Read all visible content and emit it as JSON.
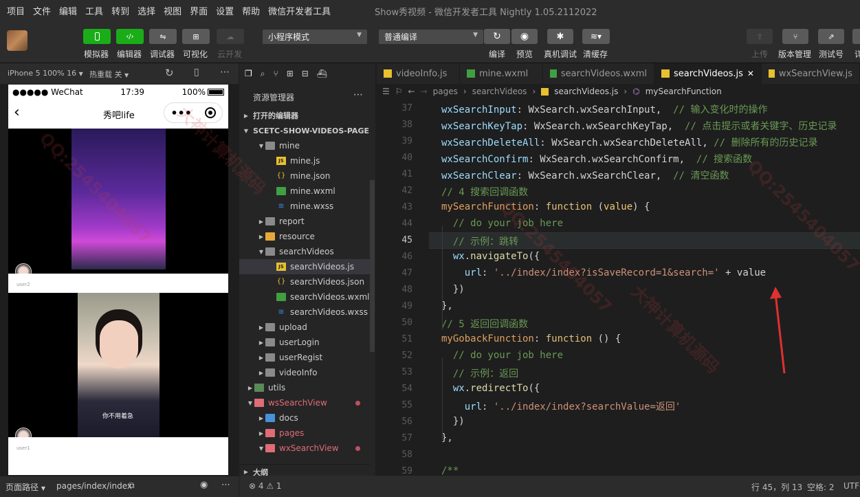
{
  "menu": [
    "项目",
    "文件",
    "编辑",
    "工具",
    "转到",
    "选择",
    "视图",
    "界面",
    "设置",
    "帮助",
    "微信开发者工具"
  ],
  "window_title": "Show秀视频 - 微信开发者工具 Nightly 1.05.2112022",
  "toolbar": {
    "simulator": "模拟器",
    "editor": "编辑器",
    "debugger": "调试器",
    "visual": "可视化",
    "cloud": "云开发",
    "mode_select": "小程序模式",
    "compile_select": "普通编译",
    "compile": "编译",
    "preview": "预览",
    "real_debug": "真机调试",
    "clear_cache": "清缓存",
    "upload": "上传",
    "version_mgmt": "版本管理",
    "test_account": "测试号",
    "details": "详"
  },
  "simulator": {
    "device": "iPhone 5 100% 16",
    "hot_reload": "热重载 关",
    "status_left": "●●●●● WeChat",
    "time": "17:39",
    "battery": "100%",
    "nav_title": "秀吧life",
    "user_top": "user2",
    "user_bottom": "user1",
    "caption": "你不用着急",
    "page_path_label": "页面路径",
    "page_path": "pages/index/index"
  },
  "explorer": {
    "title": "资源管理器",
    "open_editors": "打开的编辑器",
    "project": "SCETC-SHOW-VIDEOS-PAGE",
    "items": [
      {
        "label": "mine",
        "type": "folder-open",
        "indent": 1
      },
      {
        "label": "mine.js",
        "type": "js",
        "indent": 2
      },
      {
        "label": "mine.json",
        "type": "json",
        "indent": 2
      },
      {
        "label": "mine.wxml",
        "type": "wxml",
        "indent": 2
      },
      {
        "label": "mine.wxss",
        "type": "wxss",
        "indent": 2
      },
      {
        "label": "report",
        "type": "folder",
        "indent": 1
      },
      {
        "label": "resource",
        "type": "folder-src",
        "indent": 1
      },
      {
        "label": "searchVideos",
        "type": "folder-open",
        "indent": 1
      },
      {
        "label": "searchVideos.js",
        "type": "js",
        "indent": 2,
        "selected": true
      },
      {
        "label": "searchVideos.json",
        "type": "json",
        "indent": 2
      },
      {
        "label": "searchVideos.wxml",
        "type": "wxml",
        "indent": 2
      },
      {
        "label": "searchVideos.wxss",
        "type": "wxss",
        "indent": 2
      },
      {
        "label": "upload",
        "type": "folder",
        "indent": 1
      },
      {
        "label": "userLogin",
        "type": "folder",
        "indent": 1
      },
      {
        "label": "userRegist",
        "type": "folder",
        "indent": 1
      },
      {
        "label": "videoInfo",
        "type": "folder",
        "indent": 1
      },
      {
        "label": "utils",
        "type": "folder-green",
        "indent": 0
      },
      {
        "label": "wsSearchView",
        "type": "folder-red",
        "indent": 0,
        "dot": true
      },
      {
        "label": "docs",
        "type": "folder-blue",
        "indent": 1
      },
      {
        "label": "pages",
        "type": "folder-red",
        "indent": 1
      },
      {
        "label": "wxSearchView",
        "type": "folder-red",
        "indent": 1,
        "dot": true
      }
    ],
    "outline": "大纲"
  },
  "tabs": [
    "videoInfo.js",
    "mine.wxml",
    "searchVideos.wxml",
    "searchVideos.js",
    "wxSearchView.js"
  ],
  "breadcrumb": [
    "pages",
    "searchVideos",
    "searchVideos.js",
    "mySearchFunction"
  ],
  "code_lines": [
    {
      "n": "37",
      "html": "<span class=\"prop\">wxSearchInput</span>: <span class=\"obj\">WxSearch.wxSearchInput</span>,  <span class=\"cm\">// 输入变化时的操作</span>"
    },
    {
      "n": "38",
      "html": "<span class=\"prop\">wxSearchKeyTap</span>: <span class=\"obj\">WxSearch.wxSearchKeyTap</span>,  <span class=\"cm\">// 点击提示或者关键字、历史记录</span>"
    },
    {
      "n": "39",
      "html": "<span class=\"prop\">wxSearchDeleteAll</span>: <span class=\"obj\">WxSearch.wxSearchDeleteAll</span>, <span class=\"cm\">// 删除所有的历史记录</span>"
    },
    {
      "n": "40",
      "html": "<span class=\"prop\">wxSearchConfirm</span>: <span class=\"obj\">WxSearch.wxSearchConfirm</span>,  <span class=\"cm\">// 搜索函数</span>"
    },
    {
      "n": "41",
      "html": "<span class=\"prop\">wxSearchClear</span>: <span class=\"obj\">WxSearch.wxSearchClear</span>,  <span class=\"cm\">// 清空函数</span>"
    },
    {
      "n": "42",
      "html": "<span class=\"cm\">// 4 搜索回调函数</span>"
    },
    {
      "n": "43",
      "html": "<span class=\"fnname\">mySearchFunction</span>: <span class=\"kwb\">function</span> (<span class=\"param\">value</span>) {"
    },
    {
      "n": "44",
      "html": "  <span class=\"cm\">// do your job here</span>"
    },
    {
      "n": "45",
      "html": "  <span class=\"cm\">// 示例：跳转</span>"
    },
    {
      "n": "46",
      "html": "  <span class=\"prop\">wx</span>.<span class=\"fn\">navigateTo</span>({"
    },
    {
      "n": "47",
      "html": "    <span class=\"prop\">url</span>: <span class=\"str\">'../index/index?isSaveRecord=1&amp;search='</span> + <span class=\"obj\">value</span>"
    },
    {
      "n": "48",
      "html": "  })"
    },
    {
      "n": "49",
      "html": "},"
    },
    {
      "n": "50",
      "html": "<span class=\"cm\">// 5 返回回调函数</span>"
    },
    {
      "n": "51",
      "html": "<span class=\"fnname\">myGobackFunction</span>: <span class=\"kwb\">function</span> () {"
    },
    {
      "n": "52",
      "html": "  <span class=\"cm\">// do your job here</span>"
    },
    {
      "n": "53",
      "html": "  <span class=\"cm\">// 示例：返回</span>"
    },
    {
      "n": "54",
      "html": "  <span class=\"prop\">wx</span>.<span class=\"fn\">redirectTo</span>({"
    },
    {
      "n": "55",
      "html": "    <span class=\"prop\">url</span>: <span class=\"str\">'../index/index?searchValue=返回'</span>"
    },
    {
      "n": "56",
      "html": "  })"
    },
    {
      "n": "57",
      "html": "},"
    },
    {
      "n": "58",
      "html": ""
    },
    {
      "n": "59",
      "html": "<span class=\"cm\">/**</span>"
    }
  ],
  "current_line": "45",
  "status": {
    "problems": "⊗ 4 ⚠ 1",
    "cursor": "行 45，列 13",
    "spaces": "空格: 2",
    "encoding": "UTF-"
  },
  "watermarks": [
    "QQ:2545404057",
    "大神计算机源码",
    "QQ:2545404057",
    "大神计算机源码",
    "QQ:2545404057"
  ]
}
